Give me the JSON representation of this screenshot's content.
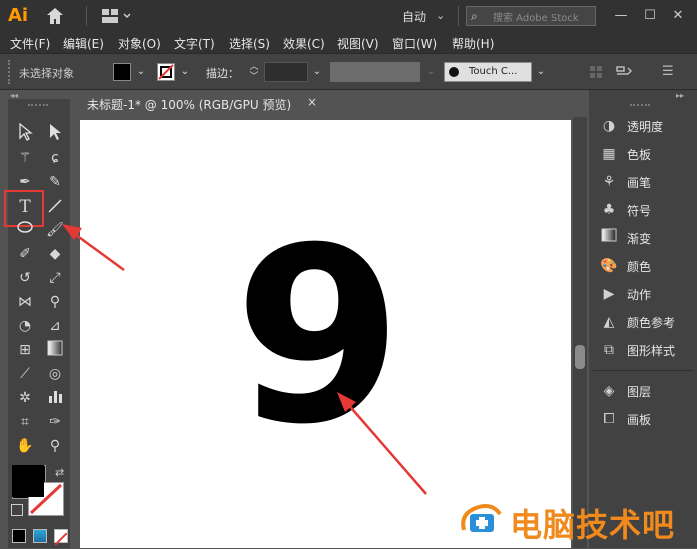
{
  "app": {
    "logo": "Ai"
  },
  "titlebar": {
    "workspace": "自动",
    "search_placeholder": "搜索 Adobe Stock"
  },
  "menu": [
    "文件(F)",
    "编辑(E)",
    "对象(O)",
    "文字(T)",
    "选择(S)",
    "效果(C)",
    "视图(V)",
    "窗口(W)",
    "帮助(H)"
  ],
  "control": {
    "selection_status": "未选择对象",
    "stroke_label": "描边：",
    "brush_name": "Touch C..."
  },
  "document": {
    "tab_label": "未标题-1* @ 100% (RGB/GPU 预览)",
    "close": "×",
    "content": "9"
  },
  "right_panel": {
    "items": [
      {
        "label": "透明度",
        "icon": "transparency-icon"
      },
      {
        "label": "色板",
        "icon": "swatches-icon"
      },
      {
        "label": "画笔",
        "icon": "brushes-icon"
      },
      {
        "label": "符号",
        "icon": "symbols-icon"
      },
      {
        "label": "渐变",
        "icon": "gradient-icon"
      },
      {
        "label": "颜色",
        "icon": "color-icon"
      },
      {
        "label": "动作",
        "icon": "actions-icon"
      },
      {
        "label": "颜色参考",
        "icon": "color-guide-icon"
      },
      {
        "label": "图形样式",
        "icon": "graphic-styles-icon"
      },
      {
        "label": "图层",
        "icon": "layers-icon"
      },
      {
        "label": "画板",
        "icon": "artboards-icon"
      }
    ]
  },
  "colors": {
    "accent": "#ff9a00",
    "highlight": "#e53935",
    "watermark": "#f08a1c"
  },
  "watermark": {
    "text": "电脑技术吧"
  }
}
